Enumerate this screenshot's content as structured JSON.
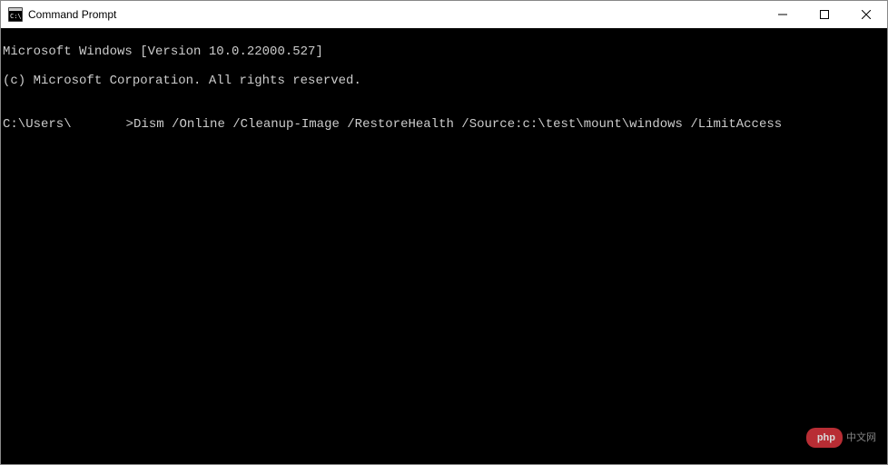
{
  "window": {
    "title": "Command Prompt"
  },
  "terminal": {
    "line1": "Microsoft Windows [Version 10.0.22000.527]",
    "line2": "(c) Microsoft Corporation. All rights reserved.",
    "blank": "",
    "prompt_prefix": "C:\\Users\\",
    "prompt_suffix": ">",
    "command": "Dism /Online /Cleanup-Image /RestoreHealth /Source:c:\\test\\mount\\windows /LimitAccess"
  },
  "watermark": {
    "badge": "php",
    "text": "中文网"
  }
}
